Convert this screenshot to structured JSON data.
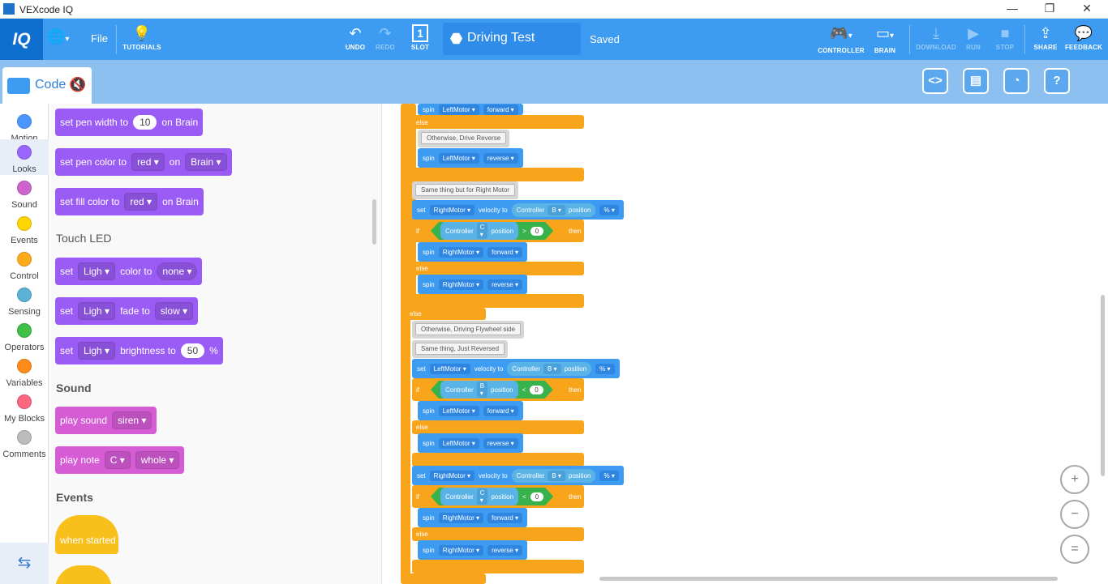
{
  "window": {
    "title": "VEXcode IQ",
    "minimize": "—",
    "restore": "❐",
    "close": "✕"
  },
  "menubar": {
    "logo": "IQ",
    "file": "File",
    "tutorials": "TUTORIALS",
    "undo": "UNDO",
    "redo": "REDO",
    "slot": "SLOT",
    "slot_number": "1",
    "project_name": "Driving Test",
    "saved": "Saved",
    "controller": "CONTROLLER",
    "brain": "BRAIN",
    "download": "DOWNLOAD",
    "run": "RUN",
    "stop": "STOP",
    "share": "SHARE",
    "feedback": "FEEDBACK"
  },
  "subbar": {
    "code_tab": "Code"
  },
  "categories": [
    {
      "label": "Motion",
      "color": "#4c97ff"
    },
    {
      "label": "Looks",
      "color": "#9966ff"
    },
    {
      "label": "Sound",
      "color": "#cf63cf"
    },
    {
      "label": "Events",
      "color": "#ffd500"
    },
    {
      "label": "Control",
      "color": "#ffab19"
    },
    {
      "label": "Sensing",
      "color": "#5cb1d6"
    },
    {
      "label": "Operators",
      "color": "#40bf4a"
    },
    {
      "label": "Variables",
      "color": "#ff8c1a"
    },
    {
      "label": "My Blocks",
      "color": "#ff6680"
    },
    {
      "label": "Comments",
      "color": "#bcbcbc"
    }
  ],
  "palette": {
    "pen_width": {
      "a": "set pen width to",
      "v": "10",
      "b": "on Brain"
    },
    "pen_color": {
      "a": "set pen color to",
      "v": "red",
      "b": "on",
      "c": "Brain"
    },
    "fill_color": {
      "a": "set fill color to",
      "v": "red",
      "b": "on Brain"
    },
    "touch_led_header": "Touch LED",
    "led_color": {
      "a": "set",
      "v": "Ligh",
      "b": "color to",
      "c": "none"
    },
    "led_fade": {
      "a": "set",
      "v": "Ligh",
      "b": "fade to",
      "c": "slow"
    },
    "led_brightness": {
      "a": "set",
      "v": "Ligh",
      "b": "brightness to",
      "c": "50",
      "d": "%"
    },
    "sound_header": "Sound",
    "play_sound": {
      "a": "play sound",
      "v": "siren"
    },
    "play_note": {
      "a": "play note",
      "v": "C",
      "b": "whole"
    },
    "events_header": "Events",
    "when_started": "when started"
  },
  "workspace": {
    "spin": "spin",
    "set": "set",
    "if": "if",
    "then": "then",
    "else": "else",
    "velocity_to": "velocity to",
    "controller": "Controller",
    "position": "position",
    "percent": "%",
    "left_motor": "LeftMotor",
    "right_motor": "RightMotor",
    "forward": "forward",
    "reverse": "reverse",
    "gt": ">",
    "lt": "<",
    "zero": "0",
    "axis_c": "C",
    "axis_b": "B",
    "comment_otherwise_reverse": "Otherwise, Drive Reverse",
    "comment_right_motor": "Same thing but for Right Motor",
    "comment_flywheel": "Otherwise, Driving Flywheel side",
    "comment_reversed": "Same thing, Just Reversed"
  },
  "zoom": {
    "in": "+",
    "out": "−",
    "reset": "="
  }
}
